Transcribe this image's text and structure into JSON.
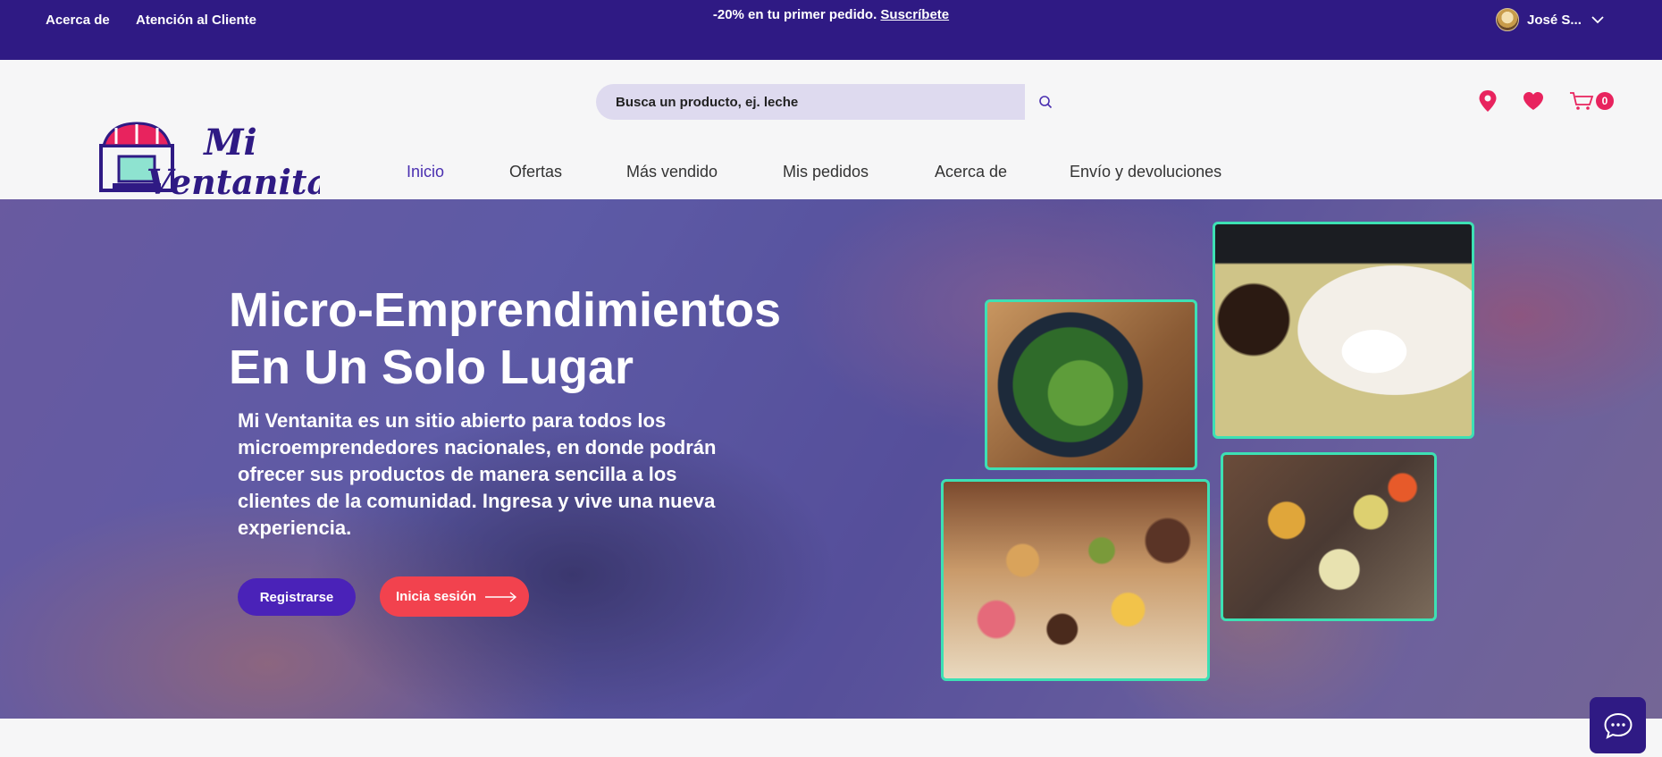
{
  "topbar": {
    "links": [
      "Acerca de",
      "Atención al Cliente"
    ],
    "promo_text": "-20% en tu primer pedido.",
    "promo_link": "Suscríbete",
    "user_name": "José S..."
  },
  "header": {
    "search_placeholder": "Busca un producto, ej. leche",
    "cart_count": "0",
    "nav": [
      "Inicio",
      "Ofertas",
      "Más vendido",
      "Mis pedidos",
      "Acerca de",
      "Envío y devoluciones"
    ],
    "active_nav": "Inicio"
  },
  "logo": {
    "line1": "Mi",
    "line2": "Ventanita"
  },
  "hero": {
    "title_line1": "Micro-Emprendimientos",
    "title_line2": "En Un Solo Lugar",
    "description": "Mi Ventanita es un sitio abierto para todos los microemprendedores nacionales, en donde podrán ofrecer sus productos de manera sencilla a los clientes de la comunidad. Ingresa y vive una nueva experiencia.",
    "register_label": "Registrarse",
    "login_label": "Inicia sesión"
  },
  "colors": {
    "brand": "#2f1a84",
    "accent": "#e8235e",
    "frame": "#3de0b4",
    "login": "#f2424e"
  }
}
